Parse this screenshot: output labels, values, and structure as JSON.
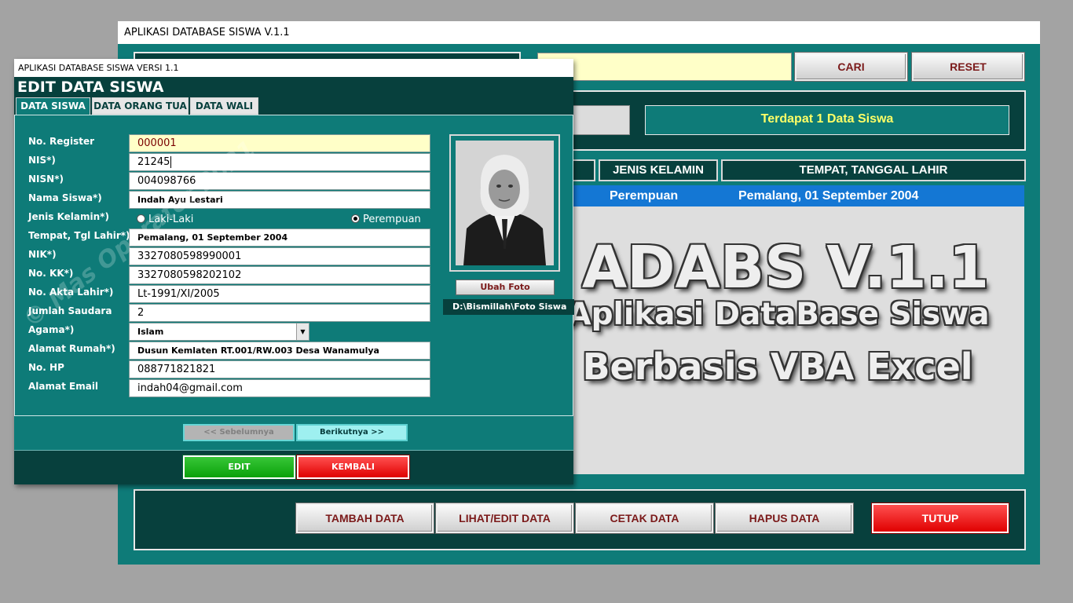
{
  "main_window": {
    "title": "APLIKASI DATABASE SISWA V.1.1",
    "search": {
      "value": "",
      "cari_label": "CARI",
      "reset_label": "RESET"
    },
    "count_text": "Terdapat 1  Data Siswa",
    "columns": [
      "JENIS KELAMIN",
      "TEMPAT, TANGGAL LAHIR"
    ],
    "rows": [
      {
        "jenis_kelamin": "Perempuan",
        "ttl": "Pemalang, 01 September 2004"
      }
    ],
    "bottom_buttons": {
      "tambah": "TAMBAH DATA",
      "lihat_edit": "LIHAT/EDIT DATA",
      "cetak": "CETAK DATA",
      "hapus": "HAPUS DATA",
      "tutup": "TUTUP"
    },
    "colors": {
      "teal": "#0e7b78",
      "dark_teal": "#07403d",
      "highlight": "#1477d4",
      "count_text": "#ffff66"
    }
  },
  "overlay": {
    "title": "ADABS V.1.1",
    "subtitle1": "Aplikasi DataBase Siswa",
    "subtitle2": "Berbasis VBA Excel"
  },
  "dialog": {
    "window_title": "APLIKASI DATABASE SISWA VERSI 1.1",
    "header": "EDIT DATA SISWA",
    "tabs": [
      "DATA SISWA",
      "DATA ORANG TUA",
      "DATA WALI"
    ],
    "watermark": "© Mas Operator 2021",
    "fields": {
      "no_register": {
        "label": "No. Register",
        "value": "000001"
      },
      "nis": {
        "label": "NIS*)",
        "value": "21245"
      },
      "nisn": {
        "label": "NISN*)",
        "value": "004098766"
      },
      "nama": {
        "label": "Nama Siswa*)",
        "value": "Indah Ayu Lestari"
      },
      "jenis_kelamin": {
        "label": "Jenis Kelamin*)",
        "option_male": "Laki-Laki",
        "option_female": "Perempuan",
        "selected": "Perempuan"
      },
      "ttl": {
        "label": "Tempat, Tgl Lahir*)",
        "value": "Pemalang, 01 September 2004"
      },
      "nik": {
        "label": "NIK*)",
        "value": "3327080598990001"
      },
      "no_kk": {
        "label": "No. KK*)",
        "value": "3327080598202102"
      },
      "akta": {
        "label": "No. Akta Lahir*)",
        "value": "Lt-1991/XI/2005"
      },
      "saudara": {
        "label": "Jumlah Saudara",
        "value": "2"
      },
      "agama": {
        "label": "Agama*)",
        "value": "Islam"
      },
      "alamat": {
        "label": "Alamat Rumah*)",
        "value": "Dusun Kemlaten RT.001/RW.003 Desa Wanamulya"
      },
      "hp": {
        "label": "No. HP",
        "value": "088771821821"
      },
      "email": {
        "label": "Alamat Email",
        "value": "indah04@gmail.com"
      }
    },
    "photo": {
      "ubah_label": "Ubah Foto",
      "path": "D:\\Bismillah\\Foto Siswa"
    },
    "nav": {
      "prev": "<< Sebelumnya",
      "next": "Berikutnya >>"
    },
    "actions": {
      "edit": "EDIT",
      "kembali": "KEMBALI"
    }
  }
}
